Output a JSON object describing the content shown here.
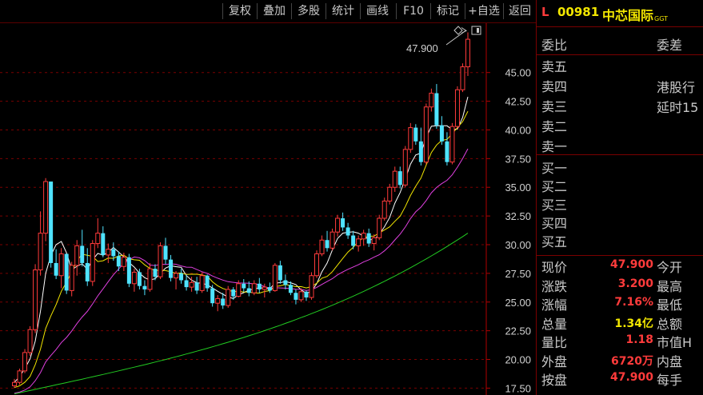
{
  "toolbar": {
    "buttons": [
      "复权",
      "叠加",
      "多股",
      "统计",
      "画线",
      "F10",
      "标记",
      "+自选",
      "返回"
    ]
  },
  "stock": {
    "prefix": "L",
    "code": "00981",
    "name": "中芯国际",
    "tag": "GGT"
  },
  "order_book": {
    "header_left": "委比",
    "header_right": "委差",
    "sell_labels": [
      "卖五",
      "卖四",
      "卖三",
      "卖二",
      "卖一"
    ],
    "buy_labels": [
      "买一",
      "买二",
      "买三",
      "买四",
      "买五"
    ],
    "notice_line1": "港股行",
    "notice_line2": "延时15"
  },
  "quote": {
    "rows": [
      {
        "label": "现价",
        "value": "47.900",
        "color": "#ff3b3b",
        "label2": "今开"
      },
      {
        "label": "涨跌",
        "value": "3.200",
        "color": "#ff3b3b",
        "label2": "最高"
      },
      {
        "label": "涨幅",
        "value": "7.16%",
        "color": "#ff3b3b",
        "label2": "最低"
      },
      {
        "label": "总量",
        "value": "1.34亿",
        "color": "#f2e600",
        "label2": "总额"
      },
      {
        "label": "量比",
        "value": "1.18",
        "color": "#ff3b3b",
        "label2": "市值H"
      },
      {
        "label": "外盘",
        "value": "6720万",
        "color": "#ff3b3b",
        "label2": "内盘"
      },
      {
        "label": "按盘",
        "value": "47.900",
        "color": "#ff3b3b",
        "label2": "每手"
      }
    ]
  },
  "chart_data": {
    "type": "candlestick",
    "y_axis_ticks": [
      17.5,
      20.0,
      22.5,
      25.0,
      27.5,
      30.0,
      32.5,
      35.0,
      37.5,
      40.0,
      42.5,
      45.0
    ],
    "y_axis_labels": [
      "17.50",
      "20.00",
      "22.50",
      "25.00",
      "27.50",
      "30.00",
      "32.50",
      "35.00",
      "37.50",
      "40.00",
      "42.50",
      "45.00"
    ],
    "ylim": [
      16.9,
      49.3
    ],
    "last_price_label": "47.900",
    "colors": {
      "up": "#ff3b3b",
      "down": "#4fe3ff",
      "ma5": "#ffffff",
      "ma10": "#f2e600",
      "ma20": "#e040e0",
      "ma60": "#22cc22"
    },
    "candles": [
      [
        17.7,
        18.3,
        17.5,
        18.0
      ],
      [
        18.0,
        19.2,
        17.8,
        19.0
      ],
      [
        19.0,
        20.9,
        18.8,
        20.6
      ],
      [
        20.6,
        22.9,
        20.3,
        22.6
      ],
      [
        22.6,
        28.3,
        22.3,
        27.8
      ],
      [
        27.8,
        32.9,
        27.3,
        31.0
      ],
      [
        31.0,
        35.8,
        30.3,
        35.5
      ],
      [
        35.5,
        30.2,
        28.0,
        28.4
      ],
      [
        28.4,
        29.6,
        27.0,
        27.3
      ],
      [
        27.3,
        29.7,
        26.2,
        29.2
      ],
      [
        29.2,
        28.0,
        25.7,
        26.0
      ],
      [
        26.0,
        28.5,
        25.5,
        28.2
      ],
      [
        28.2,
        30.4,
        27.3,
        29.9
      ],
      [
        29.9,
        31.3,
        28.1,
        28.4
      ],
      [
        28.4,
        29.7,
        26.4,
        26.8
      ],
      [
        26.8,
        30.4,
        26.4,
        30.1
      ],
      [
        30.1,
        32.3,
        29.7,
        31.0
      ],
      [
        31.0,
        31.6,
        28.9,
        29.1
      ],
      [
        29.1,
        30.1,
        28.4,
        29.6
      ],
      [
        29.6,
        30.2,
        28.6,
        29.0
      ],
      [
        29.0,
        29.4,
        27.7,
        28.1
      ],
      [
        28.1,
        29.3,
        27.7,
        28.9
      ],
      [
        28.9,
        29.2,
        26.3,
        26.6
      ],
      [
        26.6,
        27.9,
        25.9,
        27.6
      ],
      [
        27.6,
        27.9,
        26.1,
        26.4
      ],
      [
        26.4,
        26.9,
        25.6,
        26.1
      ],
      [
        26.1,
        28.4,
        25.9,
        27.9
      ],
      [
        27.9,
        28.3,
        26.9,
        27.2
      ],
      [
        27.2,
        30.2,
        27.0,
        29.9
      ],
      [
        29.9,
        30.6,
        28.3,
        28.7
      ],
      [
        28.7,
        29.1,
        26.8,
        27.1
      ],
      [
        27.1,
        27.7,
        26.1,
        27.5
      ],
      [
        27.5,
        27.9,
        26.6,
        26.9
      ],
      [
        26.9,
        27.4,
        26.0,
        26.3
      ],
      [
        26.3,
        27.2,
        25.9,
        26.7
      ],
      [
        26.7,
        27.2,
        25.7,
        26.0
      ],
      [
        26.0,
        27.6,
        25.8,
        27.3
      ],
      [
        27.3,
        27.4,
        25.9,
        26.2
      ],
      [
        26.2,
        26.5,
        24.6,
        24.9
      ],
      [
        24.9,
        25.6,
        24.2,
        25.3
      ],
      [
        25.3,
        25.8,
        24.4,
        24.7
      ],
      [
        24.7,
        26.4,
        24.5,
        26.1
      ],
      [
        26.1,
        26.3,
        25.2,
        25.5
      ],
      [
        25.5,
        26.9,
        25.4,
        26.6
      ],
      [
        26.6,
        27.0,
        25.9,
        26.2
      ],
      [
        26.2,
        26.8,
        25.5,
        25.8
      ],
      [
        25.8,
        26.9,
        25.6,
        26.6
      ],
      [
        26.6,
        27.1,
        25.8,
        26.1
      ],
      [
        26.1,
        26.6,
        25.4,
        26.3
      ],
      [
        26.3,
        26.7,
        25.8,
        26.0
      ],
      [
        26.0,
        28.4,
        25.9,
        28.2
      ],
      [
        28.2,
        28.6,
        26.6,
        26.9
      ],
      [
        26.9,
        27.4,
        26.1,
        26.5
      ],
      [
        26.5,
        26.8,
        25.6,
        25.8
      ],
      [
        25.8,
        26.1,
        24.8,
        25.2
      ],
      [
        25.2,
        26.2,
        25.0,
        25.9
      ],
      [
        25.9,
        26.0,
        25.1,
        25.4
      ],
      [
        25.4,
        27.6,
        25.2,
        27.3
      ],
      [
        27.3,
        29.5,
        27.1,
        29.2
      ],
      [
        29.2,
        30.8,
        29.0,
        30.4
      ],
      [
        30.4,
        31.2,
        29.4,
        29.7
      ],
      [
        29.7,
        31.4,
        29.5,
        31.1
      ],
      [
        31.1,
        32.6,
        30.7,
        32.3
      ],
      [
        32.3,
        32.8,
        31.2,
        31.5
      ],
      [
        31.5,
        31.9,
        30.5,
        30.8
      ],
      [
        30.8,
        31.2,
        29.6,
        29.9
      ],
      [
        29.9,
        30.8,
        29.4,
        30.5
      ],
      [
        30.5,
        31.3,
        29.9,
        31.0
      ],
      [
        31.0,
        31.4,
        29.8,
        30.1
      ],
      [
        30.1,
        30.9,
        29.5,
        30.6
      ],
      [
        30.6,
        32.6,
        30.4,
        32.3
      ],
      [
        32.3,
        34.1,
        32.1,
        33.8
      ],
      [
        33.8,
        35.3,
        33.5,
        35.0
      ],
      [
        35.0,
        36.8,
        34.6,
        36.4
      ],
      [
        36.4,
        36.8,
        34.9,
        35.2
      ],
      [
        35.2,
        38.6,
        35.0,
        38.3
      ],
      [
        38.3,
        40.6,
        38.0,
        40.2
      ],
      [
        40.2,
        40.5,
        38.7,
        39.0
      ],
      [
        39.0,
        40.2,
        36.9,
        37.2
      ],
      [
        37.2,
        42.3,
        37.0,
        42.0
      ],
      [
        42.0,
        43.6,
        41.6,
        43.2
      ],
      [
        43.2,
        44.0,
        40.1,
        40.4
      ],
      [
        40.4,
        41.2,
        38.7,
        39.0
      ],
      [
        39.0,
        39.8,
        36.9,
        37.2
      ],
      [
        37.2,
        40.6,
        37.0,
        40.3
      ],
      [
        40.3,
        43.8,
        40.1,
        43.5
      ],
      [
        43.5,
        45.8,
        43.3,
        45.5
      ],
      [
        45.5,
        48.5,
        44.7,
        47.9
      ]
    ]
  }
}
